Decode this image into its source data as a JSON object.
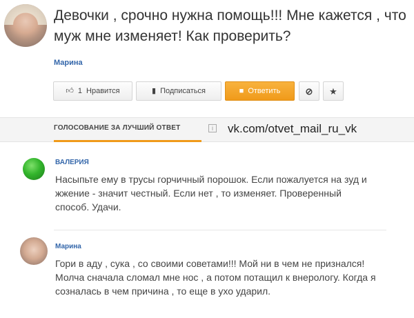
{
  "question": {
    "title": "Девочки , срочно нужна помощь!!! Мне кажется , что муж мне  изменяет! Как проверить?",
    "author": "Марина"
  },
  "actions": {
    "like_count": "1",
    "like_label": "Нравится",
    "subscribe_label": "Подписаться",
    "answer_label": "Ответить"
  },
  "voting": {
    "label": "ГОЛОСОВАНИЕ ЗА ЛУЧШИЙ ОТВЕТ",
    "info_glyph": "i",
    "watermark": "vk.com/otvet_mail_ru_vk"
  },
  "answers": [
    {
      "author": "ВАЛЕРИЯ",
      "text": "Насыпьте ему в трусы горчичный порошок. Если пожалуется на зуд и жжение - значит честный. Если нет , то изменяет. Проверенный способ. Удачи."
    },
    {
      "author": "Марина",
      "text": "Гори в аду , сука , со своими советами!!! Мой ни в чем не признался! Молча сначала сломал мне нос , а потом потащил к внерологу. Когда я созналась в чем причина , то еще в ухо ударил."
    }
  ],
  "colors": {
    "accent": "#f09a1a",
    "link": "#3366aa"
  }
}
